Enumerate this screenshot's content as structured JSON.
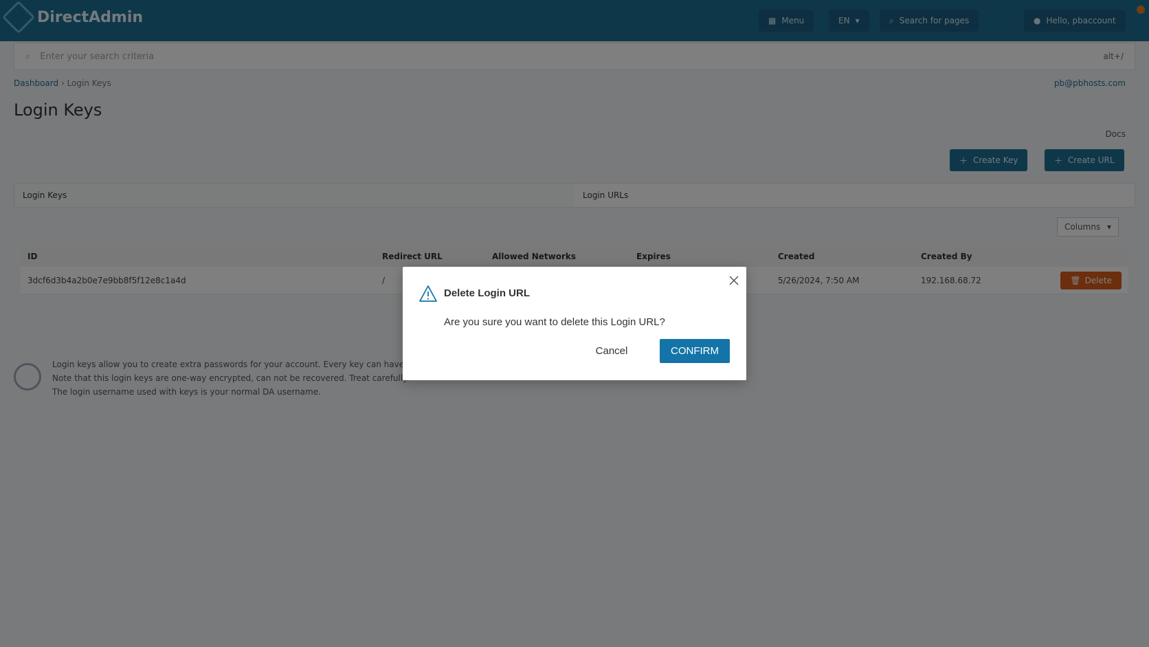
{
  "header": {
    "brand": "DirectAdmin",
    "menu_label": "Menu",
    "language": "EN",
    "search_pages_label": "Search for pages",
    "user_label": "Hello, pbaccount"
  },
  "search": {
    "placeholder": "Enter your search criteria",
    "shortcut": "alt+/"
  },
  "breadcrumb": {
    "home": "Dashboard",
    "current": "Login Keys"
  },
  "user_email": "pb@pbhosts.com",
  "page": {
    "title": "Login Keys",
    "docs_link": "Docs"
  },
  "actions": {
    "create_key": "Create Key",
    "create_url": "Create URL"
  },
  "tabs": [
    {
      "label": "Login Keys"
    },
    {
      "label": "Login URLs"
    }
  ],
  "table": {
    "column_filter": "Columns",
    "headers": {
      "id": "ID",
      "redirect_url": "Redirect URL",
      "allowed_networks": "Allowed Networks",
      "expires": "Expires",
      "created": "Created",
      "created_by": "Created By"
    },
    "rows": [
      {
        "id": "3dcf6d3b4a2b0e7e9bb8f5f12e8c1a4d",
        "redirect_url": "/",
        "allowed_networks": "",
        "expires": "",
        "created": "5/26/2024, 7:50 AM",
        "created_by": "192.168.68.72",
        "delete_label": "Delete"
      }
    ]
  },
  "info": {
    "line1": "Login keys allow you to create extra passwords for your account. Every key can have different restrictions, expiry dates and allowed IP addresses or commands.",
    "line2": "Note that this login keys are one-way encrypted, can not be recovered. Treat carefully.",
    "line3": "The login username used with keys is your normal DA username."
  },
  "modal": {
    "title": "Delete Login URL",
    "message": "Are you sure you want to delete this Login URL?",
    "cancel_label": "Cancel",
    "confirm_label": "CONFIRM"
  },
  "colors": {
    "primary": "#1474a8",
    "header": "#1f6f95",
    "danger": "#d85d1a",
    "overlay": "rgba(0,0,0,0.5)"
  }
}
